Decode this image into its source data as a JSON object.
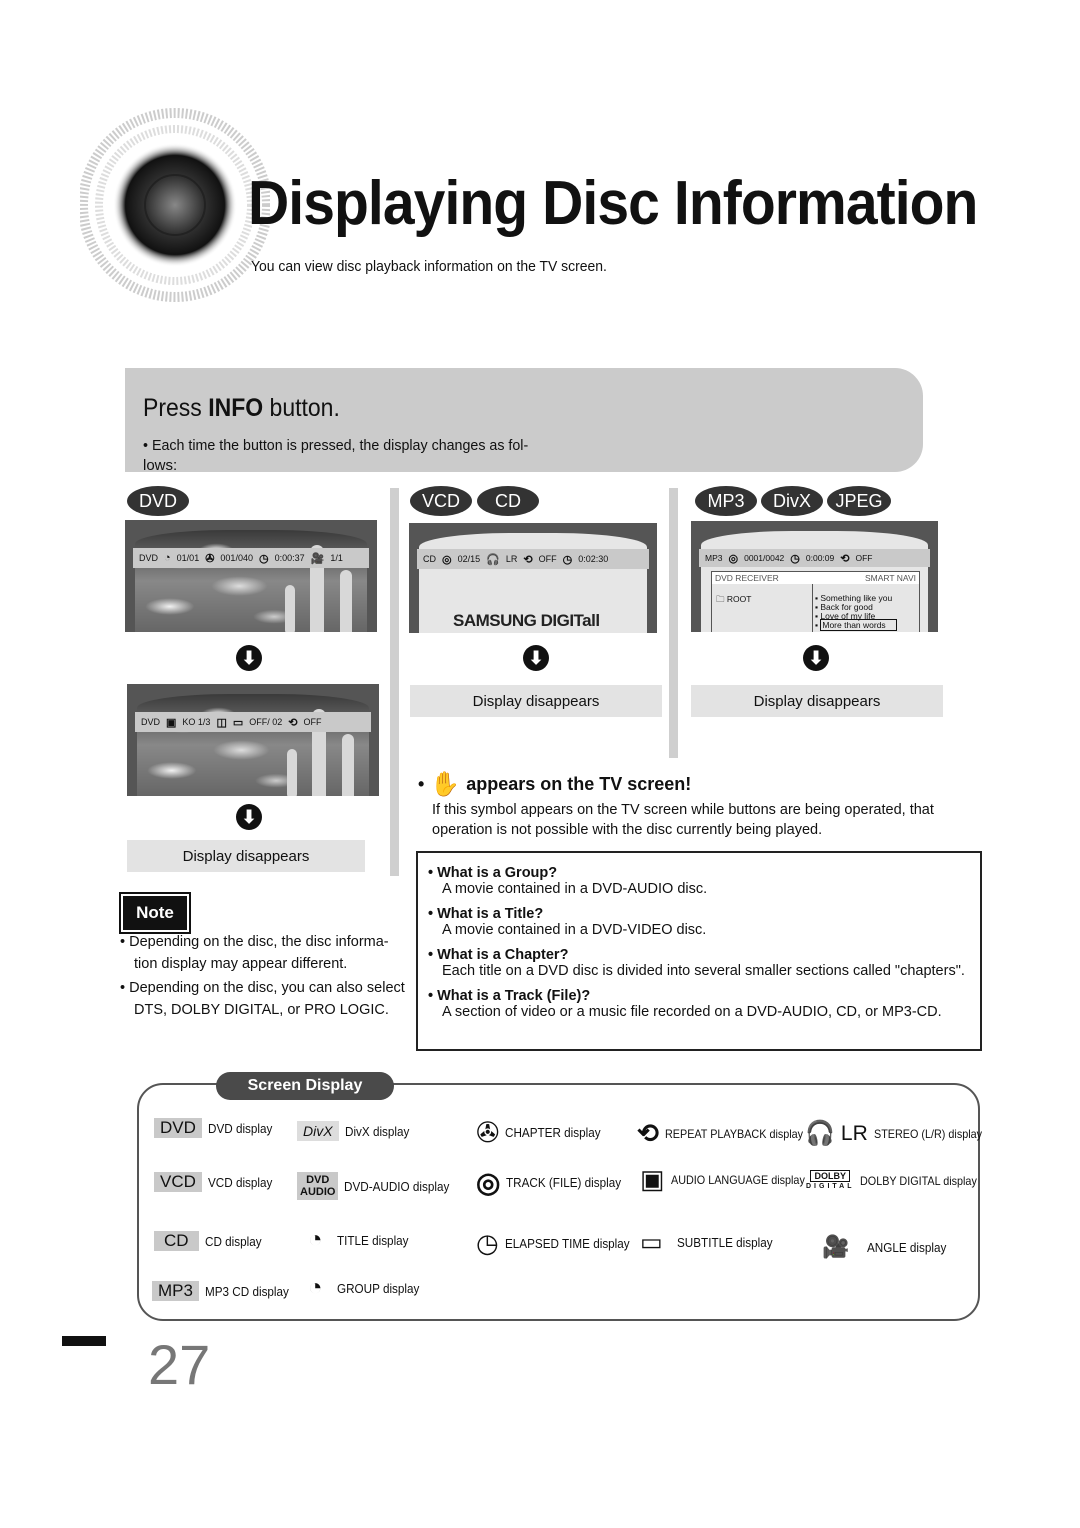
{
  "header": {
    "title": "Displaying Disc Information",
    "subtitle": "You can view disc playback information  on the TV screen."
  },
  "press_info": {
    "prefix": "Press ",
    "bold": "INFO",
    "suffix": " button.",
    "bullet": "• Each time the button is pressed, the display changes as fol-",
    "bullet_cont": "lows:"
  },
  "disc_tags": {
    "dvd": "DVD",
    "vcd": "VCD",
    "cd": "CD",
    "mp3": "MP3",
    "divx": "DivX",
    "jpeg": "JPEG"
  },
  "dvd_screen_1": {
    "disc": "DVD",
    "title": "01/01",
    "chapter": "001/040",
    "time": "0:00:37",
    "angle": "1/1"
  },
  "dvd_screen_2": {
    "disc": "DVD",
    "audio": "KO 1/3",
    "subtitle": "OFF/  02",
    "repeat": "OFF"
  },
  "cd_screen": {
    "disc": "CD",
    "track": "02/15",
    "stereo": "LR",
    "repeat": "OFF",
    "time": "0:02:30",
    "logo": "SAMSUNG DIGITall"
  },
  "mp3_screen": {
    "disc": "MP3",
    "track": "0001/0042",
    "time": "0:00:09",
    "repeat": "OFF",
    "panel_left": "DVD RECEIVER",
    "panel_right": "SMART NAVI",
    "folder": "ROOT",
    "files": [
      "Something like you",
      "Back for good",
      "Love of my life",
      "More than words"
    ]
  },
  "display_disappears": "Display disappears",
  "hand_notice": {
    "heading": "appears on the TV screen!",
    "description": "If this symbol appears on the TV screen while buttons are being operated, that operation is not possible with the disc currently being played."
  },
  "note": {
    "label": "Note",
    "items": [
      "• Depending on the disc, the disc informa-tion display may appear different.",
      "• Depending on the disc, you can also select DTS, DOLBY DIGITAL, or PRO LOGIC."
    ]
  },
  "faq": [
    {
      "q": "• What is a Group?",
      "a": "A movie contained in a DVD-AUDIO disc."
    },
    {
      "q": "• What is a Title?",
      "a": "A movie contained in a DVD-VIDEO disc."
    },
    {
      "q": "• What is a Chapter?",
      "a": "Each title on a DVD disc is divided into several smaller sections called \"chapters\"."
    },
    {
      "q": "• What is a Track (File)?",
      "a": "A section of video or a music file recorded on a DVD-AUDIO, CD, or MP3-CD."
    }
  ],
  "screen_display": {
    "heading": "Screen Display",
    "items": {
      "dvd": {
        "tag": "DVD",
        "label": "DVD display"
      },
      "vcd": {
        "tag": "VCD",
        "label": "VCD display"
      },
      "cd": {
        "tag": "CD",
        "label": "CD display"
      },
      "mp3": {
        "tag": "MP3",
        "label": "MP3 CD display"
      },
      "divx": {
        "tag": "DivX",
        "label": "DivX display"
      },
      "dvdaudio": {
        "tag1": "DVD",
        "tag2": "AUDIO",
        "label": "DVD-AUDIO display"
      },
      "title": {
        "label": "TITLE display"
      },
      "group": {
        "label": "GROUP display"
      },
      "chapter": {
        "label": "CHAPTER display"
      },
      "track": {
        "label": "TRACK (FILE) display"
      },
      "elapsed": {
        "label": "ELAPSED TIME display"
      },
      "repeat": {
        "label": "REPEAT PLAYBACK display"
      },
      "audio_lang": {
        "label": "AUDIO LANGUAGE display"
      },
      "subtitle": {
        "label": "SUBTITLE display"
      },
      "stereo": {
        "tag": "LR",
        "label": "STEREO (L/R) display"
      },
      "dolby": {
        "tag": "DOLBY",
        "sub": "DIGITAL",
        "label": "DOLBY DIGITAL display"
      },
      "angle": {
        "label": "ANGLE display"
      }
    }
  },
  "page_number": "27"
}
